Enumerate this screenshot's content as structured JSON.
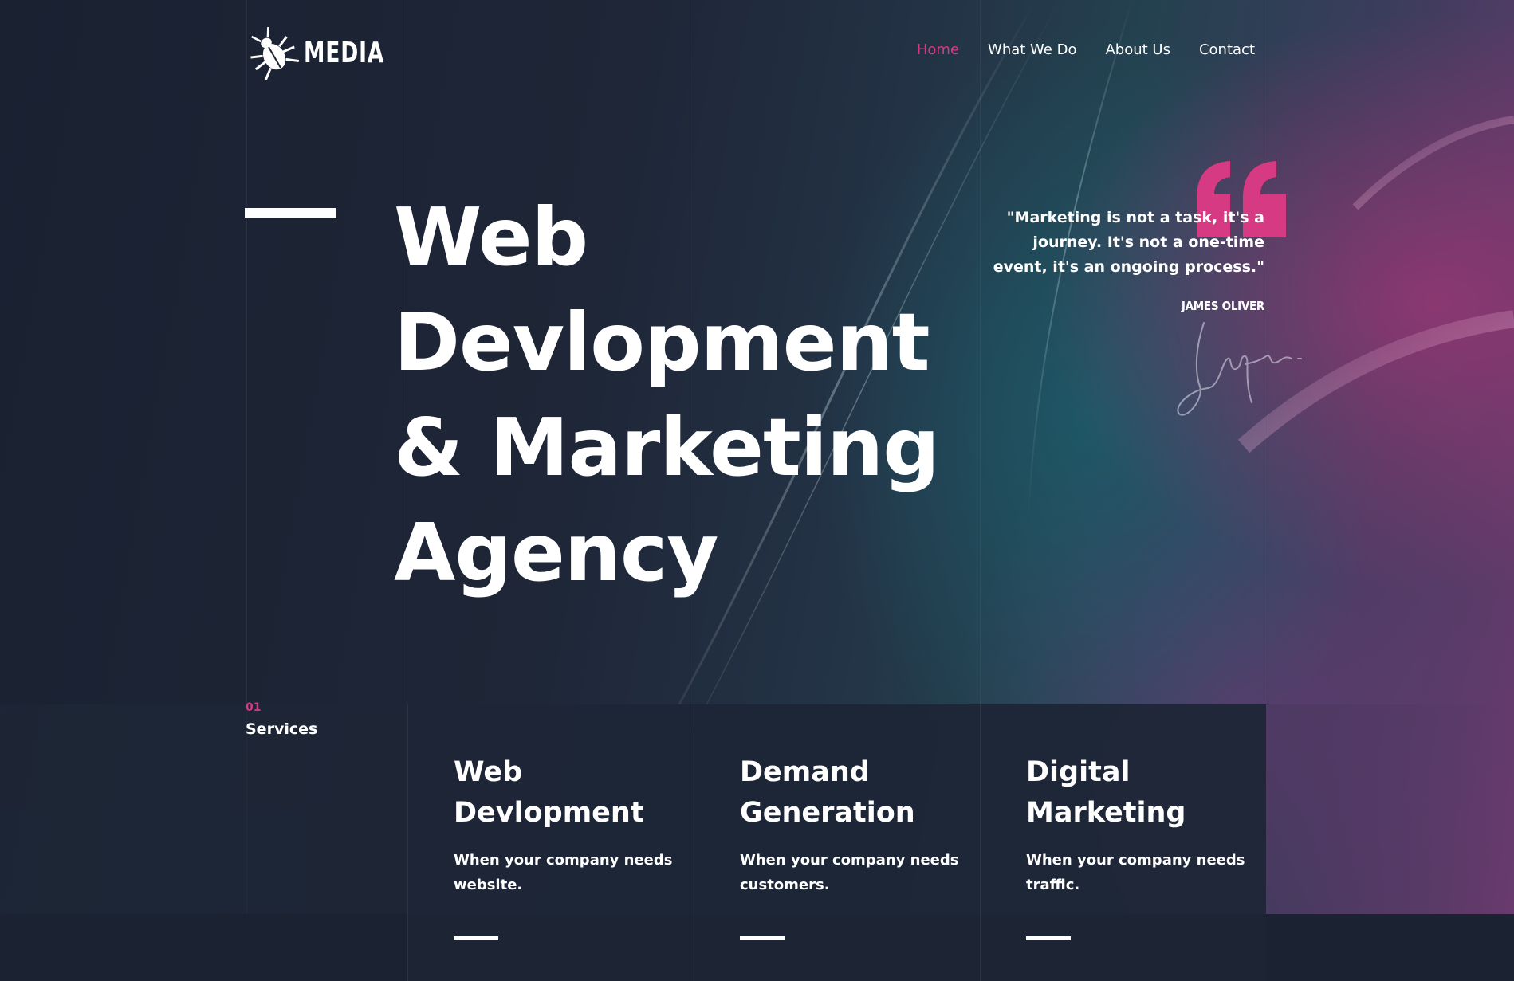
{
  "brand": {
    "logo_text": "MEDIA",
    "logo_icon": "beetle-icon"
  },
  "nav": {
    "items": [
      {
        "label": "Home",
        "active": true
      },
      {
        "label": "What We Do",
        "active": false
      },
      {
        "label": "About Us",
        "active": false
      },
      {
        "label": "Contact",
        "active": false
      }
    ]
  },
  "hero": {
    "title_lines": [
      "Web",
      "Devlopment",
      "& Marketing",
      "Agency"
    ]
  },
  "quote": {
    "icon": "quote-mark-icon",
    "text": "\"Marketing is not a task, it's a journey. It's not a one-time event, it's an ongoing process.\"",
    "author": "JAMES OLIVER"
  },
  "services": {
    "number": "01",
    "label": "Services",
    "cards": [
      {
        "title": "Web Devlopment",
        "desc": "When your company needs website."
      },
      {
        "title": "Demand Generation",
        "desc": "When your company needs customers."
      },
      {
        "title": "Digital Marketing",
        "desc": "When your company needs traffic."
      }
    ]
  },
  "colors": {
    "accent": "#d63a82",
    "background": "#1b2232",
    "text": "#ffffff"
  }
}
